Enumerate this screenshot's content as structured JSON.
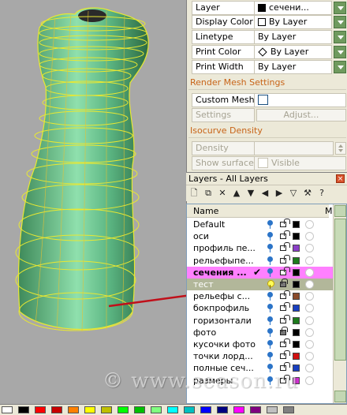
{
  "properties": {
    "rows": [
      {
        "label": "Layer",
        "value": "сечени...",
        "swatch": "#000000",
        "kind": "square"
      },
      {
        "label": "Display Color",
        "value": "By Layer",
        "kind": "outline"
      },
      {
        "label": "Linetype",
        "value": "By Layer",
        "kind": "none"
      },
      {
        "label": "Print Color",
        "value": "By Layer",
        "kind": "diamond"
      },
      {
        "label": "Print Width",
        "value": "By Layer",
        "kind": "none"
      }
    ],
    "render_mesh_title": "Render Mesh Settings",
    "custom_mesh_label": "Custom Mesh",
    "settings_label": "Settings",
    "adjust_label": "Adjust...",
    "isocurve_title": "Isocurve Density",
    "density_label": "Density",
    "show_surface_label": "Show surface...",
    "visible_label": "Visible"
  },
  "layers": {
    "title": "Layers - All Layers",
    "close_icon": "×",
    "header_name": "Name",
    "header_m": "M",
    "rows": [
      {
        "name": "Default",
        "color": "#000000",
        "lock": "open",
        "bulb": "off",
        "state": ""
      },
      {
        "name": "оси",
        "color": "#000000",
        "lock": "open",
        "bulb": "off",
        "state": ""
      },
      {
        "name": "профиль пе...",
        "color": "#8b3fc8",
        "lock": "open",
        "bulb": "off",
        "state": ""
      },
      {
        "name": "рельефыпе...",
        "color": "#1d7a1d",
        "lock": "open",
        "bulb": "off",
        "state": ""
      },
      {
        "name": "сечения ...",
        "color": "#000000",
        "lock": "open",
        "bulb": "off",
        "state": "current",
        "check": "✔"
      },
      {
        "name": "тест",
        "color": "#000000",
        "lock": "closed",
        "bulb": "on",
        "state": "selected"
      },
      {
        "name": "рельефы с...",
        "color": "#8a4b2b",
        "lock": "open",
        "bulb": "off",
        "state": ""
      },
      {
        "name": "бокпрофиль",
        "color": "#1a3fc0",
        "lock": "open",
        "bulb": "off",
        "state": ""
      },
      {
        "name": "горизонтали",
        "color": "#1d7a1d",
        "lock": "open",
        "bulb": "off",
        "state": ""
      },
      {
        "name": "фото",
        "color": "#000000",
        "lock": "closed",
        "bulb": "off",
        "state": ""
      },
      {
        "name": "кусочки фото",
        "color": "#000000",
        "lock": "open",
        "bulb": "off",
        "state": ""
      },
      {
        "name": "точки лорд...",
        "color": "#d01010",
        "lock": "open",
        "bulb": "off",
        "state": ""
      },
      {
        "name": "полные сеч...",
        "color": "#1a3fc0",
        "lock": "open",
        "bulb": "off",
        "state": ""
      },
      {
        "name": "размеры",
        "color": "#d030d0",
        "lock": "open",
        "bulb": "off",
        "state": ""
      }
    ]
  },
  "toolbar_icons": [
    "new-layer-icon",
    "new-sublayer-icon",
    "delete-icon",
    "move-up-icon",
    "move-down-icon",
    "move-out-icon",
    "move-in-icon",
    "filter-icon",
    "tools-icon",
    "help-icon"
  ],
  "palette": [
    "#ffffff",
    "#000000",
    "#ff0000",
    "#c80000",
    "#ff8000",
    "#ffff00",
    "#c0c000",
    "#00ff00",
    "#00c000",
    "#80ff80",
    "#00ffff",
    "#00c0c0",
    "#0000ff",
    "#000080",
    "#ff00ff",
    "#800080",
    "#c0c0c0",
    "#808080"
  ],
  "watermark": "© www.season.ru"
}
